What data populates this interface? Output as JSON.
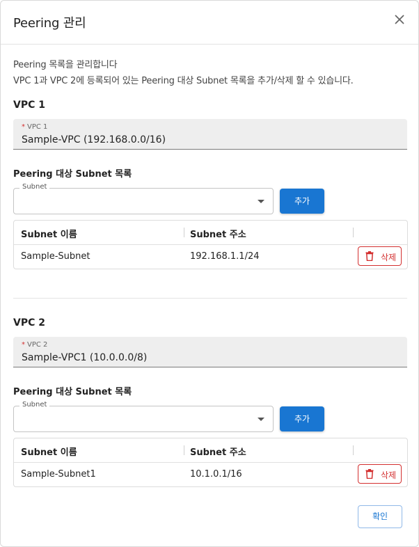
{
  "dialog": {
    "title": "Peering 관리",
    "close_icon": "close-icon",
    "desc_line1": "Peering 목록을 관리합니다",
    "desc_line2": "VPC 1과 VPC 2에 등록되어 있는 Peering 대상 Subnet 목록을 추가/삭제 할 수 있습니다."
  },
  "vpc1": {
    "section_title": "VPC 1",
    "field_required_mark": "*",
    "field_label": "VPC 1",
    "field_value": "Sample-VPC (192.168.0.0/16)",
    "subnet_list_title": "Peering 대상 Subnet 목록",
    "select_legend": "Subnet",
    "select_value": "",
    "add_label": "추가",
    "table": {
      "columns": [
        "Subnet 이름",
        "Subnet 주소",
        ""
      ],
      "rows": [
        {
          "name": "Sample-Subnet",
          "address": "192.168.1.1/24",
          "delete_label": "삭제",
          "delete_icon": "trash-icon"
        }
      ]
    }
  },
  "vpc2": {
    "section_title": "VPC 2",
    "field_required_mark": "*",
    "field_label": "VPC 2",
    "field_value": "Sample-VPC1 (10.0.0.0/8)",
    "subnet_list_title": "Peering 대상 Subnet 목록",
    "select_legend": "Subnet",
    "select_value": "",
    "add_label": "추가",
    "table": {
      "columns": [
        "Subnet 이름",
        "Subnet 주소",
        ""
      ],
      "rows": [
        {
          "name": "Sample-Subnet1",
          "address": "10.1.0.1/16",
          "delete_label": "삭제",
          "delete_icon": "trash-icon"
        }
      ]
    }
  },
  "footer": {
    "confirm_label": "확인"
  },
  "colors": {
    "primary": "#1976d2",
    "danger": "#d32f2f",
    "required": "#d32f2f",
    "field_bg": "#eeeeee"
  }
}
